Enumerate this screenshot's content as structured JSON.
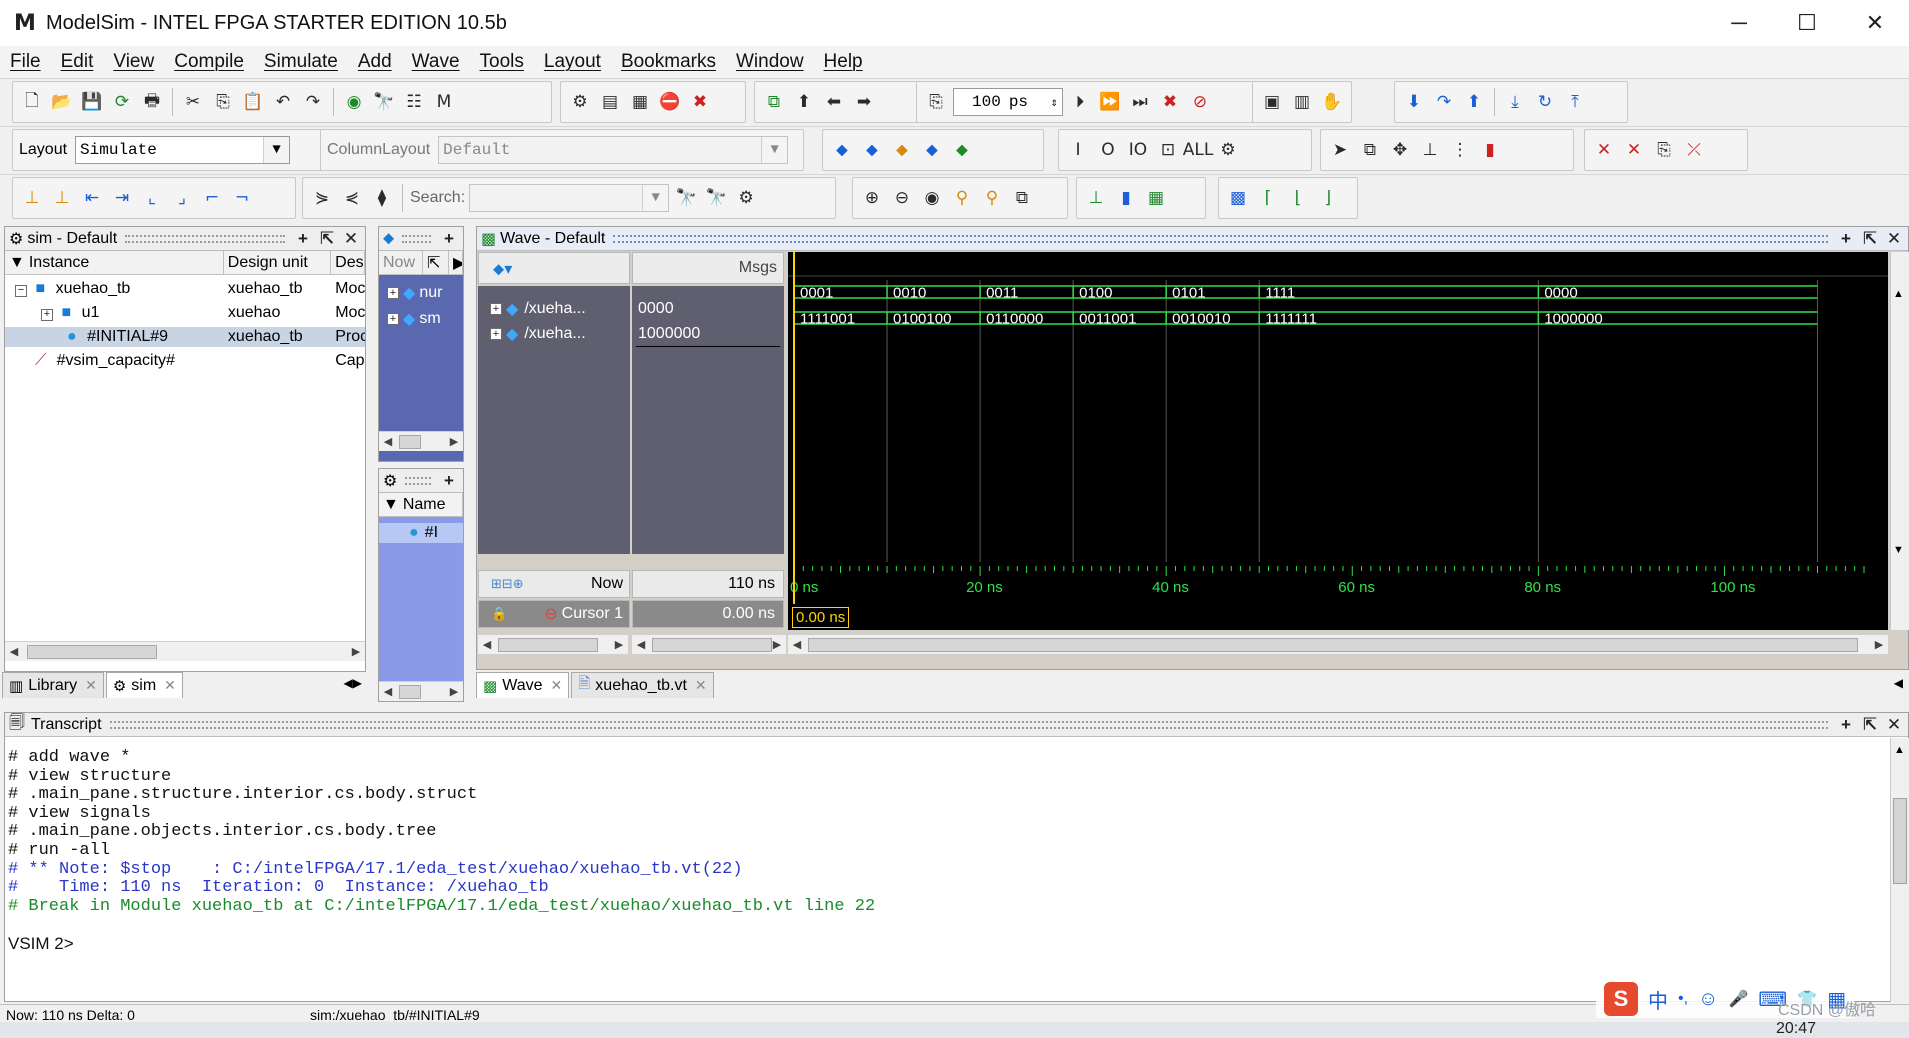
{
  "window": {
    "title": "ModelSim - INTEL FPGA STARTER EDITION 10.5b",
    "logo_icon": "modelsim-logo-icon",
    "controls": {
      "minimize": "─",
      "maximize": "☐",
      "close": "✕"
    }
  },
  "menu": [
    "File",
    "Edit",
    "View",
    "Compile",
    "Simulate",
    "Add",
    "Wave",
    "Tools",
    "Layout",
    "Bookmarks",
    "Window",
    "Help"
  ],
  "toolbar": {
    "run_length_value": "100",
    "run_length_unit": "ps",
    "layout_label": "Layout",
    "layout_value": "Simulate",
    "column_layout_label": "ColumnLayout",
    "column_layout_value": "Default",
    "search_label": "Search:",
    "search_value": ""
  },
  "sim_panel": {
    "title": "sim - Default",
    "columns": [
      "Instance",
      "Design unit",
      "Des"
    ],
    "rows": [
      {
        "instance": "xuehao_tb",
        "design_unit": "xuehao_tb",
        "type": "Moc",
        "expander": "−",
        "icon": "module-icon"
      },
      {
        "instance": "u1",
        "design_unit": "xuehao",
        "type": "Moc",
        "expander": "+",
        "icon": "module-icon"
      },
      {
        "instance": "#INITIAL#9",
        "design_unit": "xuehao_tb",
        "type": "Proc",
        "expander": "",
        "icon": "process-icon",
        "selected": true
      },
      {
        "instance": "#vsim_capacity#",
        "design_unit": "",
        "type": "Cap",
        "expander": "",
        "icon": "capacity-icon"
      }
    ],
    "tabs": [
      {
        "label": "Library",
        "icon": "library-icon"
      },
      {
        "label": "sim",
        "icon": "sim-icon"
      }
    ]
  },
  "objects_panel": {
    "now_label": "Now",
    "items": [
      "nur",
      "sm"
    ]
  },
  "processes_panel": {
    "column": "Name",
    "items": [
      "#I"
    ]
  },
  "wave": {
    "title": "Wave - Default",
    "msgs_label": "Msgs",
    "signals": [
      {
        "name": "/xueha...",
        "value": "0000"
      },
      {
        "name": "/xueha...",
        "value": "1000000"
      }
    ],
    "now_label": "Now",
    "now_value": "110 ns",
    "cursor_label": "Cursor 1",
    "cursor_value": "0.00 ns",
    "cursor_marker": "0.00 ns",
    "time_labels": [
      "0 ns",
      "20 ns",
      "40 ns",
      "60 ns",
      "80 ns",
      "100 ns"
    ],
    "time_ticks_ns": [
      0,
      20,
      40,
      60,
      80,
      100
    ],
    "time_range_ns": [
      0,
      115
    ],
    "bus1_segments": [
      {
        "t": 0,
        "v": "0001"
      },
      {
        "t": 10,
        "v": "0010"
      },
      {
        "t": 20,
        "v": "0011"
      },
      {
        "t": 30,
        "v": "0100"
      },
      {
        "t": 40,
        "v": "0101"
      },
      {
        "t": 50,
        "v": "1111"
      },
      {
        "t": 80,
        "v": "0000"
      }
    ],
    "bus2_segments": [
      {
        "t": 0,
        "v": "1111001"
      },
      {
        "t": 10,
        "v": "0100100"
      },
      {
        "t": 20,
        "v": "0110000"
      },
      {
        "t": 30,
        "v": "0011001"
      },
      {
        "t": 40,
        "v": "0010010"
      },
      {
        "t": 50,
        "v": "1111111"
      },
      {
        "t": 80,
        "v": "1000000"
      }
    ],
    "wave_end_ns": 110,
    "tabs": [
      {
        "label": "Wave",
        "icon": "wave-icon"
      },
      {
        "label": "xuehao_tb.vt",
        "icon": "source-file-icon"
      }
    ],
    "colors": {
      "bus": "#33e04a",
      "cursor": "#ffd200",
      "grid": "#5a5a5a",
      "timeline": "#33e04a"
    }
  },
  "transcript": {
    "title": "Transcript",
    "lines": [
      {
        "text": "# add wave *",
        "kind": "cmd"
      },
      {
        "text": "# view structure",
        "kind": "cmd"
      },
      {
        "text": "# .main_pane.structure.interior.cs.body.struct",
        "kind": "cmd"
      },
      {
        "text": "# view signals",
        "kind": "cmd"
      },
      {
        "text": "# .main_pane.objects.interior.cs.body.tree",
        "kind": "cmd"
      },
      {
        "text": "# run -all",
        "kind": "cmd"
      },
      {
        "text": "# ** Note: $stop    : C:/intelFPGA/17.1/eda_test/xuehao/xuehao_tb.vt(22)",
        "kind": "note"
      },
      {
        "text": "#    Time: 110 ns  Iteration: 0  Instance: /xuehao_tb",
        "kind": "note"
      },
      {
        "text": "# Break in Module xuehao_tb at C:/intelFPGA/17.1/eda_test/xuehao/xuehao_tb.vt line 22",
        "kind": "brk"
      },
      {
        "text": "",
        "kind": "cmd"
      },
      {
        "text": "VSIM 2>",
        "kind": "prompt"
      }
    ]
  },
  "status_bar": {
    "now_text": "Now: 110 ns  Delta: 0",
    "path_text": "sim:/xuehao_tb/#INITIAL#9"
  },
  "ime_bar": {
    "items": [
      "中",
      "•,",
      "☺",
      "🎤",
      "⌨",
      "👕",
      "▦"
    ]
  },
  "clock": "20:47",
  "watermark": "CSDN @傲哈"
}
